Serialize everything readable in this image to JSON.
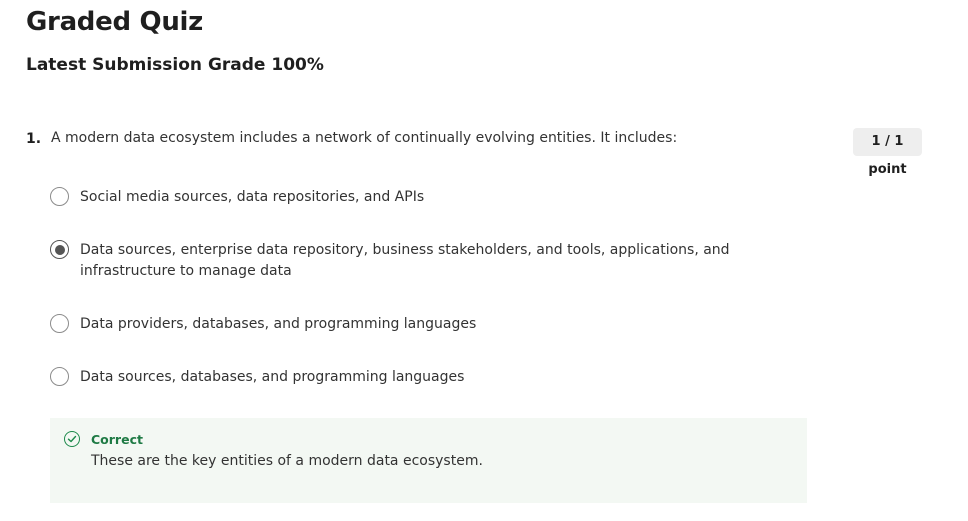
{
  "quiz": {
    "title": "Graded Quiz",
    "grade_label": "Latest Submission Grade",
    "grade_value": "100%"
  },
  "question": {
    "number": "1.",
    "text": "A modern data ecosystem includes a network of continually evolving entities. It includes:",
    "points": "1 / 1 point",
    "options": [
      {
        "label": "Social media sources, data repositories, and APIs",
        "selected": false
      },
      {
        "label": "Data sources, enterprise data repository, business stakeholders, and tools, applications, and infrastructure to manage data",
        "selected": true
      },
      {
        "label": "Data providers, databases, and programming languages",
        "selected": false
      },
      {
        "label": "Data sources, databases, and programming languages",
        "selected": false
      }
    ]
  },
  "feedback": {
    "status": "Correct",
    "message": "These are the key entities of a modern data ecosystem.",
    "icon": "check-circle-icon",
    "accent_color": "#1e8a4c",
    "background_color": "#f3f8f3"
  }
}
